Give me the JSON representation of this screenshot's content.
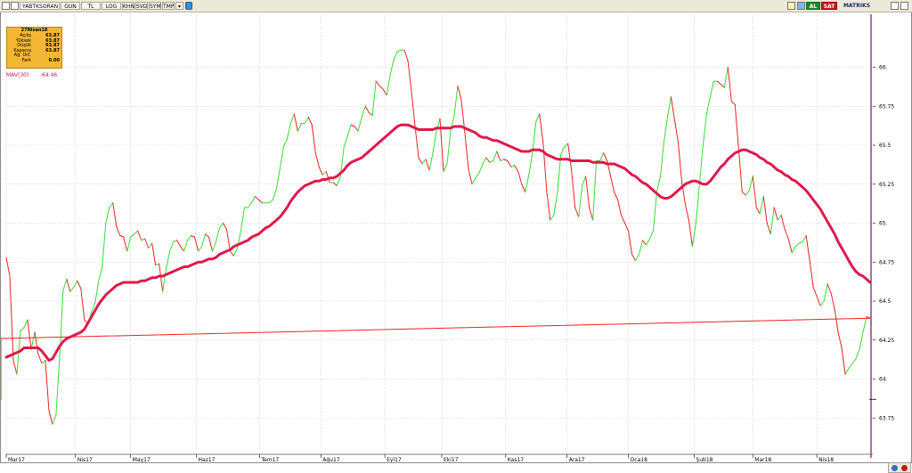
{
  "toolbar": {
    "symbol": "YABTKSORAN",
    "buttons": [
      "GUN",
      "TL",
      "LOG",
      "KHN",
      "SVD",
      "SYM",
      "TMP"
    ],
    "buy_label": "AL",
    "sell_label": "SAT",
    "brand": "MATRIKS"
  },
  "info_box": {
    "date": "27Nisan18",
    "rows": [
      {
        "label": "Açılış",
        "value": "63.87"
      },
      {
        "label": "Yüksek",
        "value": "63.87"
      },
      {
        "label": "Düşük",
        "value": "63.87"
      },
      {
        "label": "Kapanış",
        "value": "63.87"
      },
      {
        "label": "Ağ. Ort.",
        "value": ""
      },
      {
        "label": "Fark",
        "value": "0.00"
      }
    ]
  },
  "indicator": {
    "label": "MAV(30)",
    "value": ":64.46"
  },
  "colors": {
    "up": "#33dd33",
    "down": "#ee2222",
    "mav": "#e0194a",
    "grid": "#bdbdbd",
    "marker": "#7a2a6a"
  },
  "chart_data": {
    "type": "line",
    "x": [
      0,
      4,
      8,
      12,
      16,
      20,
      24,
      28,
      32,
      36,
      40,
      44,
      48,
      52,
      56,
      60,
      64,
      68,
      72,
      76,
      80,
      84,
      88,
      92,
      96,
      100,
      104,
      108,
      112,
      116,
      120,
      124,
      128,
      132,
      136,
      140,
      144,
      148,
      152,
      156,
      160,
      164,
      168,
      172,
      176,
      180,
      184,
      188,
      192,
      196,
      200,
      204,
      208,
      212,
      216,
      220,
      224,
      228,
      232,
      236,
      240,
      244,
      248,
      252,
      256,
      260,
      264,
      268,
      272,
      276,
      280,
      284,
      288,
      292,
      296,
      300,
      304,
      308,
      312,
      316,
      320,
      324,
      328,
      332,
      336,
      340,
      344,
      348,
      352,
      356,
      360,
      364,
      368,
      372,
      376,
      380,
      384,
      388,
      392,
      396,
      400,
      404,
      408,
      412,
      416,
      420,
      424,
      428,
      432,
      436,
      440,
      444,
      448,
      452,
      456,
      460,
      464,
      468,
      472,
      476,
      480,
      484,
      488,
      492,
      496,
      500,
      504,
      508,
      512,
      516,
      520,
      524,
      528,
      532,
      536,
      540,
      544,
      548,
      552,
      556,
      560,
      564,
      568,
      572,
      576,
      580,
      584,
      588,
      592,
      596,
      600,
      604,
      608,
      612,
      616,
      620,
      624,
      628,
      632,
      636,
      640,
      644,
      648,
      652,
      656,
      660,
      664,
      668,
      672,
      676,
      680,
      684,
      688,
      692,
      696,
      700,
      704,
      708,
      712,
      716,
      720,
      724,
      728,
      732,
      736,
      740,
      744,
      748,
      752,
      756,
      760,
      764,
      768,
      772,
      776,
      780,
      784,
      788,
      792,
      796,
      800,
      804,
      808,
      812,
      816,
      820,
      824,
      828,
      832,
      836,
      840,
      844,
      848,
      852,
      856,
      860,
      864,
      868,
      872,
      876,
      880,
      884,
      888,
      892,
      896,
      900,
      904,
      908,
      912,
      916,
      920,
      924,
      928,
      932,
      936,
      940,
      944,
      948,
      952,
      956,
      960,
      964,
      968,
      972
    ],
    "close": [
      64.78,
      64.66,
      64.12,
      64.03,
      64.31,
      64.33,
      64.38,
      64.19,
      64.3,
      64.16,
      64.1,
      64.12,
      63.8,
      63.71,
      63.77,
      64.13,
      64.57,
      64.64,
      64.56,
      64.59,
      64.63,
      64.58,
      64.38,
      64.35,
      64.43,
      64.49,
      64.63,
      64.72,
      65.0,
      65.1,
      65.13,
      64.98,
      64.92,
      64.91,
      64.82,
      64.91,
      64.93,
      64.95,
      64.89,
      64.9,
      64.84,
      64.87,
      64.73,
      64.74,
      64.56,
      64.71,
      64.82,
      64.88,
      64.89,
      64.85,
      64.82,
      64.89,
      64.92,
      64.91,
      64.82,
      64.85,
      64.93,
      64.91,
      64.82,
      64.88,
      64.97,
      65.0,
      64.96,
      64.82,
      64.79,
      64.84,
      64.95,
      65.1,
      65.1,
      65.13,
      65.17,
      65.15,
      65.13,
      65.13,
      65.13,
      65.15,
      65.22,
      65.35,
      65.49,
      65.54,
      65.64,
      65.7,
      65.59,
      65.64,
      65.64,
      65.68,
      65.63,
      65.45,
      65.36,
      65.31,
      65.33,
      65.26,
      65.26,
      65.24,
      65.3,
      65.49,
      65.56,
      65.63,
      65.62,
      65.59,
      65.68,
      65.75,
      65.71,
      65.69,
      65.91,
      65.88,
      65.86,
      65.82,
      65.95,
      66.05,
      66.1,
      66.11,
      66.11,
      66.04,
      65.84,
      65.62,
      65.42,
      65.38,
      65.41,
      65.34,
      65.45,
      65.59,
      65.67,
      65.33,
      65.38,
      65.59,
      65.69,
      65.88,
      65.79,
      65.58,
      65.35,
      65.25,
      65.29,
      65.32,
      65.38,
      65.42,
      65.39,
      65.4,
      65.46,
      65.4,
      65.41,
      65.4,
      65.36,
      65.37,
      65.33,
      65.25,
      65.2,
      65.31,
      65.45,
      65.65,
      65.7,
      65.52,
      65.21,
      65.02,
      65.05,
      65.19,
      65.44,
      65.49,
      65.51,
      65.34,
      65.1,
      65.04,
      65.24,
      65.3,
      65.1,
      65.02,
      65.4,
      65.4,
      65.45,
      65.4,
      65.3,
      65.2,
      65.15,
      65.05,
      65.0,
      64.95,
      64.8,
      64.76,
      64.8,
      64.89,
      64.86,
      64.9,
      64.95,
      65.2,
      65.3,
      65.52,
      65.68,
      65.81,
      65.66,
      65.52,
      65.27,
      65.12,
      65.02,
      64.85,
      65.0,
      65.25,
      65.5,
      65.7,
      65.81,
      65.91,
      65.91,
      65.89,
      65.87,
      66.0,
      65.78,
      65.76,
      65.48,
      65.2,
      65.18,
      65.21,
      65.3,
      65.1,
      65.06,
      65.17,
      65.0,
      64.93,
      65.1,
      65.02,
      65.05,
      64.96,
      64.9,
      64.81,
      64.85,
      64.87,
      64.88,
      64.92,
      64.76,
      64.59,
      64.53,
      64.47,
      64.5,
      64.61,
      64.55,
      64.45,
      64.3,
      64.2,
      64.03,
      64.07,
      64.1,
      64.13,
      64.19,
      64.3,
      64.4,
      64.39,
      64.26,
      64.1,
      64.08,
      63.89,
      63.88,
      63.89,
      63.9,
      63.87
    ],
    "mav": [
      64.14,
      64.15,
      64.16,
      64.17,
      64.18,
      64.2,
      64.2,
      64.2,
      64.2,
      64.2,
      64.18,
      64.15,
      64.12,
      64.13,
      64.17,
      64.21,
      64.24,
      64.26,
      64.27,
      64.28,
      64.29,
      64.3,
      64.32,
      64.36,
      64.4,
      64.44,
      64.48,
      64.51,
      64.54,
      64.56,
      64.58,
      64.6,
      64.61,
      64.62,
      64.62,
      64.62,
      64.62,
      64.62,
      64.63,
      64.63,
      64.64,
      64.65,
      64.65,
      64.66,
      64.66,
      64.67,
      64.68,
      64.69,
      64.7,
      64.71,
      64.72,
      64.72,
      64.73,
      64.74,
      64.75,
      64.75,
      64.76,
      64.77,
      64.77,
      64.78,
      64.8,
      64.81,
      64.82,
      64.83,
      64.85,
      64.86,
      64.87,
      64.88,
      64.89,
      64.91,
      64.92,
      64.93,
      64.95,
      64.97,
      64.98,
      65.0,
      65.02,
      65.04,
      65.07,
      65.1,
      65.14,
      65.17,
      65.2,
      65.22,
      65.24,
      65.25,
      65.26,
      65.27,
      65.27,
      65.28,
      65.28,
      65.29,
      65.29,
      65.3,
      65.32,
      65.34,
      65.37,
      65.39,
      65.4,
      65.41,
      65.42,
      65.44,
      65.46,
      65.48,
      65.5,
      65.52,
      65.54,
      65.56,
      65.58,
      65.6,
      65.62,
      65.63,
      65.63,
      65.63,
      65.62,
      65.61,
      65.6,
      65.6,
      65.6,
      65.6,
      65.6,
      65.61,
      65.61,
      65.61,
      65.61,
      65.61,
      65.62,
      65.62,
      65.62,
      65.61,
      65.6,
      65.59,
      65.58,
      65.56,
      65.55,
      65.55,
      65.54,
      65.53,
      65.53,
      65.52,
      65.51,
      65.5,
      65.49,
      65.48,
      65.47,
      65.46,
      65.46,
      65.46,
      65.47,
      65.47,
      65.47,
      65.46,
      65.44,
      65.43,
      65.42,
      65.41,
      65.41,
      65.41,
      65.41,
      65.4,
      65.4,
      65.4,
      65.4,
      65.4,
      65.4,
      65.39,
      65.39,
      65.39,
      65.39,
      65.38,
      65.38,
      65.38,
      65.37,
      65.36,
      65.35,
      65.33,
      65.31,
      65.3,
      65.28,
      65.26,
      65.25,
      65.23,
      65.21,
      65.19,
      65.17,
      65.16,
      65.16,
      65.17,
      65.19,
      65.21,
      65.23,
      65.25,
      65.26,
      65.27,
      65.27,
      65.26,
      65.25,
      65.25,
      65.27,
      65.3,
      65.33,
      65.36,
      65.38,
      65.41,
      65.43,
      65.45,
      65.46,
      65.47,
      65.47,
      65.46,
      65.45,
      65.44,
      65.42,
      65.41,
      65.39,
      65.38,
      65.36,
      65.34,
      65.33,
      65.31,
      65.3,
      65.28,
      65.27,
      65.25,
      65.23,
      65.21,
      65.18,
      65.15,
      65.12,
      65.09,
      65.05,
      65.01,
      64.97,
      64.93,
      64.88,
      64.84,
      64.8,
      64.76,
      64.72,
      64.69,
      64.67,
      64.66,
      64.64,
      64.62,
      64.6,
      64.58,
      64.56,
      64.54,
      64.51,
      64.48,
      64.46
    ],
    "ylim": [
      63.62,
      66.34
    ],
    "yticks": [
      63.75,
      64.0,
      64.25,
      64.5,
      64.75,
      65.0,
      65.25,
      65.5,
      65.75,
      66.0
    ],
    "ytick_labels": [
      "63.75",
      "64.",
      "64.25",
      "64.5",
      "64.75",
      "65.",
      "65.25",
      "65.5",
      "65.75",
      "66."
    ],
    "xtick_labels": [
      {
        "x": 0,
        "label": "Mar17"
      },
      {
        "x": 78,
        "label": "Nis17"
      },
      {
        "x": 140,
        "label": "May17"
      },
      {
        "x": 214,
        "label": "Haz17"
      },
      {
        "x": 285,
        "label": "Tem17"
      },
      {
        "x": 354,
        "label": "Ağu17"
      },
      {
        "x": 426,
        "label": "Eyl17"
      },
      {
        "x": 490,
        "label": "Eki17"
      },
      {
        "x": 562,
        "label": "Kas17"
      },
      {
        "x": 631,
        "label": "Ara17"
      },
      {
        "x": 700,
        "label": "Oca18"
      },
      {
        "x": 774,
        "label": "Şub18"
      },
      {
        "x": 840,
        "label": "Mar18"
      },
      {
        "x": 912,
        "label": "Nis18"
      }
    ],
    "last_price": 63.87,
    "grid": true,
    "legend": "top-left"
  }
}
